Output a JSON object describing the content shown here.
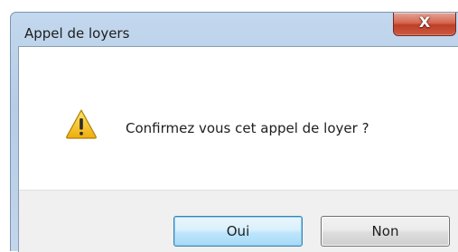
{
  "window": {
    "title": "Appel de loyers",
    "close_glyph": "X"
  },
  "dialog": {
    "icon": "warning-icon",
    "message": "Confirmez vous cet appel de loyer ?"
  },
  "buttons": {
    "yes_label": "Oui",
    "no_label": "Non"
  },
  "colors": {
    "frame": "#b9cfe7",
    "close_button": "#c9452c",
    "warning": "#f6c21b",
    "default_button_border": "#3c7fb1"
  }
}
